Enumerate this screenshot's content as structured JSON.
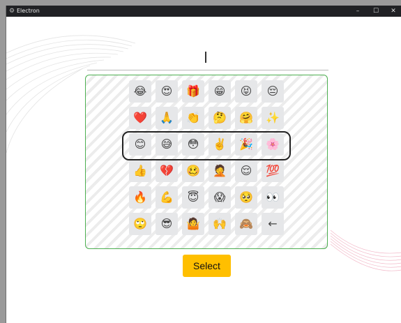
{
  "window": {
    "title": "Electron",
    "icon": "gear-icon",
    "controls": [
      "–",
      "☐",
      "✕"
    ]
  },
  "input": {
    "value": ""
  },
  "emoji_grid": {
    "rows": [
      [
        "😂",
        "😍",
        "🎁",
        "😁",
        "😝",
        "😔"
      ],
      [
        "❤️",
        "🙏",
        "👏",
        "🤔",
        "🤗",
        "✨"
      ],
      [
        "😊",
        "😅",
        "😳",
        "✌️",
        "🎉",
        "🌸"
      ],
      [
        "👍",
        "💔",
        "🥴",
        "🤦",
        "😌",
        "💯"
      ],
      [
        "🔥",
        "💪",
        "😇",
        "😱",
        "🥺",
        "👀"
      ],
      [
        "🙄",
        "😎",
        "🤷",
        "🙌",
        "🙈",
        "←"
      ]
    ],
    "highlighted_row": 2
  },
  "select_button": {
    "label": "Select"
  },
  "colors": {
    "panel_border": "#4caf50",
    "select_button_bg": "#ffbf00",
    "title_bar_bg": "#202124"
  }
}
